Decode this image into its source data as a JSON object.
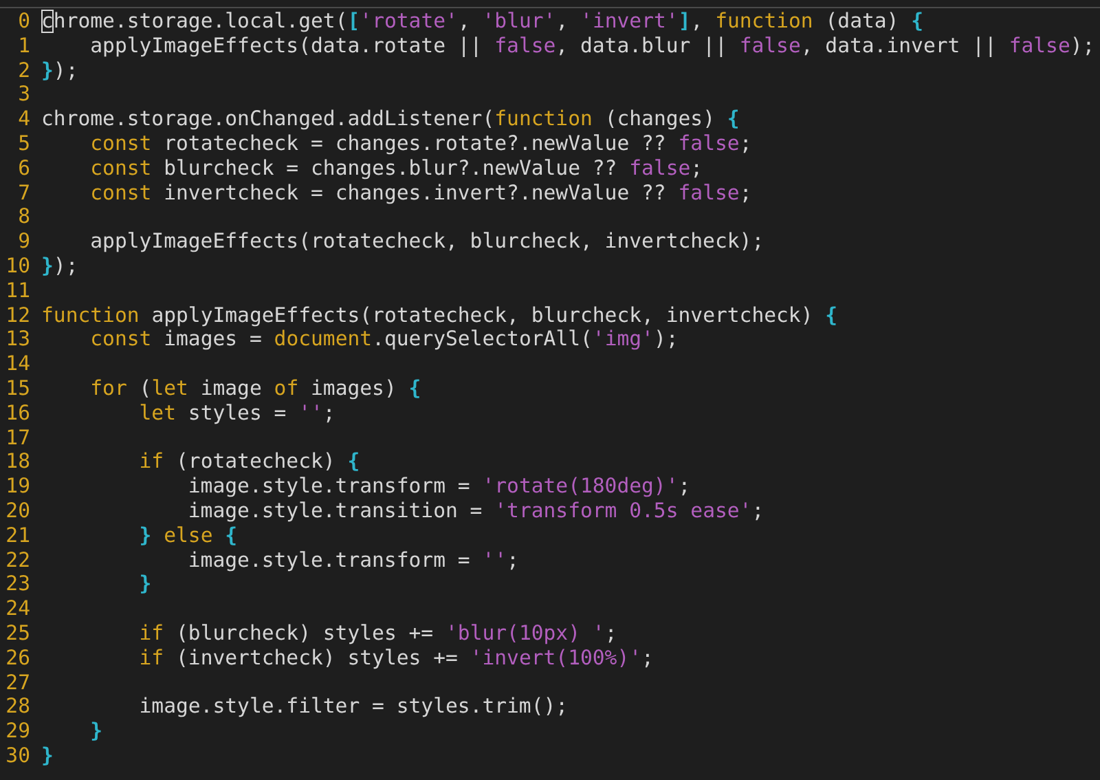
{
  "editor": {
    "lines": [
      {
        "number": "0",
        "tokens": [
          {
            "kind": "cursor",
            "text": "c"
          },
          {
            "kind": "plain",
            "text": "hrome.storage.local.get("
          },
          {
            "kind": "bracket",
            "text": "["
          },
          {
            "kind": "string",
            "text": "'rotate'"
          },
          {
            "kind": "plain",
            "text": ", "
          },
          {
            "kind": "string",
            "text": "'blur'"
          },
          {
            "kind": "plain",
            "text": ", "
          },
          {
            "kind": "string",
            "text": "'invert'"
          },
          {
            "kind": "bracket",
            "text": "]"
          },
          {
            "kind": "plain",
            "text": ", "
          },
          {
            "kind": "keyword",
            "text": "function"
          },
          {
            "kind": "plain",
            "text": " (data) "
          },
          {
            "kind": "bracket",
            "text": "{"
          }
        ]
      },
      {
        "number": "1",
        "tokens": [
          {
            "kind": "plain",
            "text": "    applyImageEffects(data.rotate || "
          },
          {
            "kind": "string",
            "text": "false"
          },
          {
            "kind": "plain",
            "text": ", data.blur || "
          },
          {
            "kind": "string",
            "text": "false"
          },
          {
            "kind": "plain",
            "text": ", data.invert || "
          },
          {
            "kind": "string",
            "text": "false"
          },
          {
            "kind": "plain",
            "text": ");"
          }
        ]
      },
      {
        "number": "2",
        "tokens": [
          {
            "kind": "bracket",
            "text": "}"
          },
          {
            "kind": "plain",
            "text": ");"
          }
        ]
      },
      {
        "number": "3"
      },
      {
        "number": "4",
        "tokens": [
          {
            "kind": "plain",
            "text": "chrome.storage.onChanged.addListener("
          },
          {
            "kind": "keyword",
            "text": "function"
          },
          {
            "kind": "plain",
            "text": " (changes) "
          },
          {
            "kind": "bracket",
            "text": "{"
          }
        ]
      },
      {
        "number": "5",
        "tokens": [
          {
            "kind": "keyword",
            "text": "    const"
          },
          {
            "kind": "plain",
            "text": " rotatecheck = changes.rotate?.newValue ?? "
          },
          {
            "kind": "string",
            "text": "false"
          },
          {
            "kind": "plain",
            "text": ";"
          }
        ]
      },
      {
        "number": "6",
        "tokens": [
          {
            "kind": "keyword",
            "text": "    const"
          },
          {
            "kind": "plain",
            "text": " blurcheck = changes.blur?.newValue ?? "
          },
          {
            "kind": "string",
            "text": "false"
          },
          {
            "kind": "plain",
            "text": ";"
          }
        ]
      },
      {
        "number": "7",
        "tokens": [
          {
            "kind": "keyword",
            "text": "    const"
          },
          {
            "kind": "plain",
            "text": " invertcheck = changes.invert?.newValue ?? "
          },
          {
            "kind": "string",
            "text": "false"
          },
          {
            "kind": "plain",
            "text": ";"
          }
        ]
      },
      {
        "number": "8"
      },
      {
        "number": "9",
        "tokens": [
          {
            "kind": "plain",
            "text": "    applyImageEffects(rotatecheck, blurcheck, invertcheck);"
          }
        ]
      },
      {
        "number": "10",
        "tokens": [
          {
            "kind": "bracket",
            "text": "}"
          },
          {
            "kind": "plain",
            "text": ");"
          }
        ]
      },
      {
        "number": "11"
      },
      {
        "number": "12",
        "tokens": [
          {
            "kind": "keyword",
            "text": "function"
          },
          {
            "kind": "plain",
            "text": " applyImageEffects(rotatecheck, blurcheck, invertcheck) "
          },
          {
            "kind": "bracket",
            "text": "{"
          }
        ]
      },
      {
        "number": "13",
        "tokens": [
          {
            "kind": "keyword",
            "text": "    const"
          },
          {
            "kind": "plain",
            "text": " images = "
          },
          {
            "kind": "keyword",
            "text": "document"
          },
          {
            "kind": "plain",
            "text": ".querySelectorAll("
          },
          {
            "kind": "string",
            "text": "'img'"
          },
          {
            "kind": "plain",
            "text": ");"
          }
        ]
      },
      {
        "number": "14"
      },
      {
        "number": "15",
        "tokens": [
          {
            "kind": "keyword",
            "text": "    for"
          },
          {
            "kind": "plain",
            "text": " ("
          },
          {
            "kind": "keyword",
            "text": "let"
          },
          {
            "kind": "plain",
            "text": " image "
          },
          {
            "kind": "keyword",
            "text": "of"
          },
          {
            "kind": "plain",
            "text": " images) "
          },
          {
            "kind": "bracket",
            "text": "{"
          }
        ]
      },
      {
        "number": "16",
        "tokens": [
          {
            "kind": "keyword",
            "text": "        let"
          },
          {
            "kind": "plain",
            "text": " styles = "
          },
          {
            "kind": "string",
            "text": "''"
          },
          {
            "kind": "plain",
            "text": ";"
          }
        ]
      },
      {
        "number": "17"
      },
      {
        "number": "18",
        "tokens": [
          {
            "kind": "keyword",
            "text": "        if"
          },
          {
            "kind": "plain",
            "text": " (rotatecheck) "
          },
          {
            "kind": "bracket",
            "text": "{"
          }
        ]
      },
      {
        "number": "19",
        "tokens": [
          {
            "kind": "plain",
            "text": "            image.style.transform = "
          },
          {
            "kind": "string",
            "text": "'rotate(180deg)'"
          },
          {
            "kind": "plain",
            "text": ";"
          }
        ]
      },
      {
        "number": "20",
        "tokens": [
          {
            "kind": "plain",
            "text": "            image.style.transition = "
          },
          {
            "kind": "string",
            "text": "'transform 0.5s ease'"
          },
          {
            "kind": "plain",
            "text": ";"
          }
        ]
      },
      {
        "number": "21",
        "tokens": [
          {
            "kind": "bracket",
            "text": "        } "
          },
          {
            "kind": "keyword",
            "text": "else"
          },
          {
            "kind": "bracket",
            "text": " {"
          }
        ]
      },
      {
        "number": "22",
        "tokens": [
          {
            "kind": "plain",
            "text": "            image.style.transform = "
          },
          {
            "kind": "string",
            "text": "''"
          },
          {
            "kind": "plain",
            "text": ";"
          }
        ]
      },
      {
        "number": "23",
        "tokens": [
          {
            "kind": "bracket",
            "text": "        }"
          }
        ]
      },
      {
        "number": "24"
      },
      {
        "number": "25",
        "tokens": [
          {
            "kind": "keyword",
            "text": "        if"
          },
          {
            "kind": "plain",
            "text": " (blurcheck) styles += "
          },
          {
            "kind": "string",
            "text": "'blur(10px) '"
          },
          {
            "kind": "plain",
            "text": ";"
          }
        ]
      },
      {
        "number": "26",
        "tokens": [
          {
            "kind": "keyword",
            "text": "        if"
          },
          {
            "kind": "plain",
            "text": " (invertcheck) styles += "
          },
          {
            "kind": "string",
            "text": "'invert(100%)'"
          },
          {
            "kind": "plain",
            "text": ";"
          }
        ]
      },
      {
        "number": "27"
      },
      {
        "number": "28",
        "tokens": [
          {
            "kind": "plain",
            "text": "        image.style.filter = styles.trim();"
          }
        ]
      },
      {
        "number": "29",
        "tokens": [
          {
            "kind": "bracket",
            "text": "    }"
          }
        ]
      },
      {
        "number": "30",
        "tokens": [
          {
            "kind": "bracket",
            "text": "}"
          }
        ]
      }
    ]
  }
}
